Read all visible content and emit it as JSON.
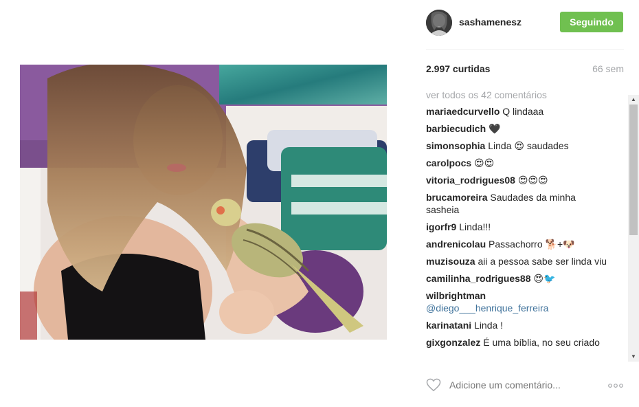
{
  "post": {
    "username": "sashamenesz",
    "follow_label": "Seguindo",
    "likes_text": "2.997 curtidas",
    "time_ago": "66 sem",
    "view_all_comments": "ver todos os 42 comentários",
    "add_comment_placeholder": "Adicione um comentário..."
  },
  "comments": [
    {
      "user": "mariaedcurvello",
      "text": "Q lindaaa"
    },
    {
      "user": "barbiecudich",
      "text": "🖤"
    },
    {
      "user": "simonsophia",
      "text": "Linda 😍 saudades"
    },
    {
      "user": "carolpocs",
      "text": "😍😍"
    },
    {
      "user": "vitoria_rodrigues08",
      "text": "😍😍😍"
    },
    {
      "user": "brucamoreira",
      "text": "Saudades da minha sasheia"
    },
    {
      "user": "igorfr9",
      "text": "Linda!!!"
    },
    {
      "user": "andrenicolau",
      "text": "Passachorro 🐕+🐶"
    },
    {
      "user": "muzisouza",
      "text": "aii a pessoa sabe ser linda viu"
    },
    {
      "user": "camilinha_rodrigues88",
      "text": "😍🐦"
    },
    {
      "user": "wilbrightman",
      "mention": "@diego___henrique_ferreira",
      "text": ""
    },
    {
      "user": "karinatani",
      "text": "Linda !"
    },
    {
      "user": "gixgonzalez",
      "text": "É uma bíblia, no seu criado"
    }
  ],
  "icons": {
    "heart": "heart-outline-icon",
    "more": "more-options-icon"
  },
  "colors": {
    "follow_button": "#70c050",
    "mention": "#3f729b",
    "muted_text": "#a5a7aa"
  }
}
